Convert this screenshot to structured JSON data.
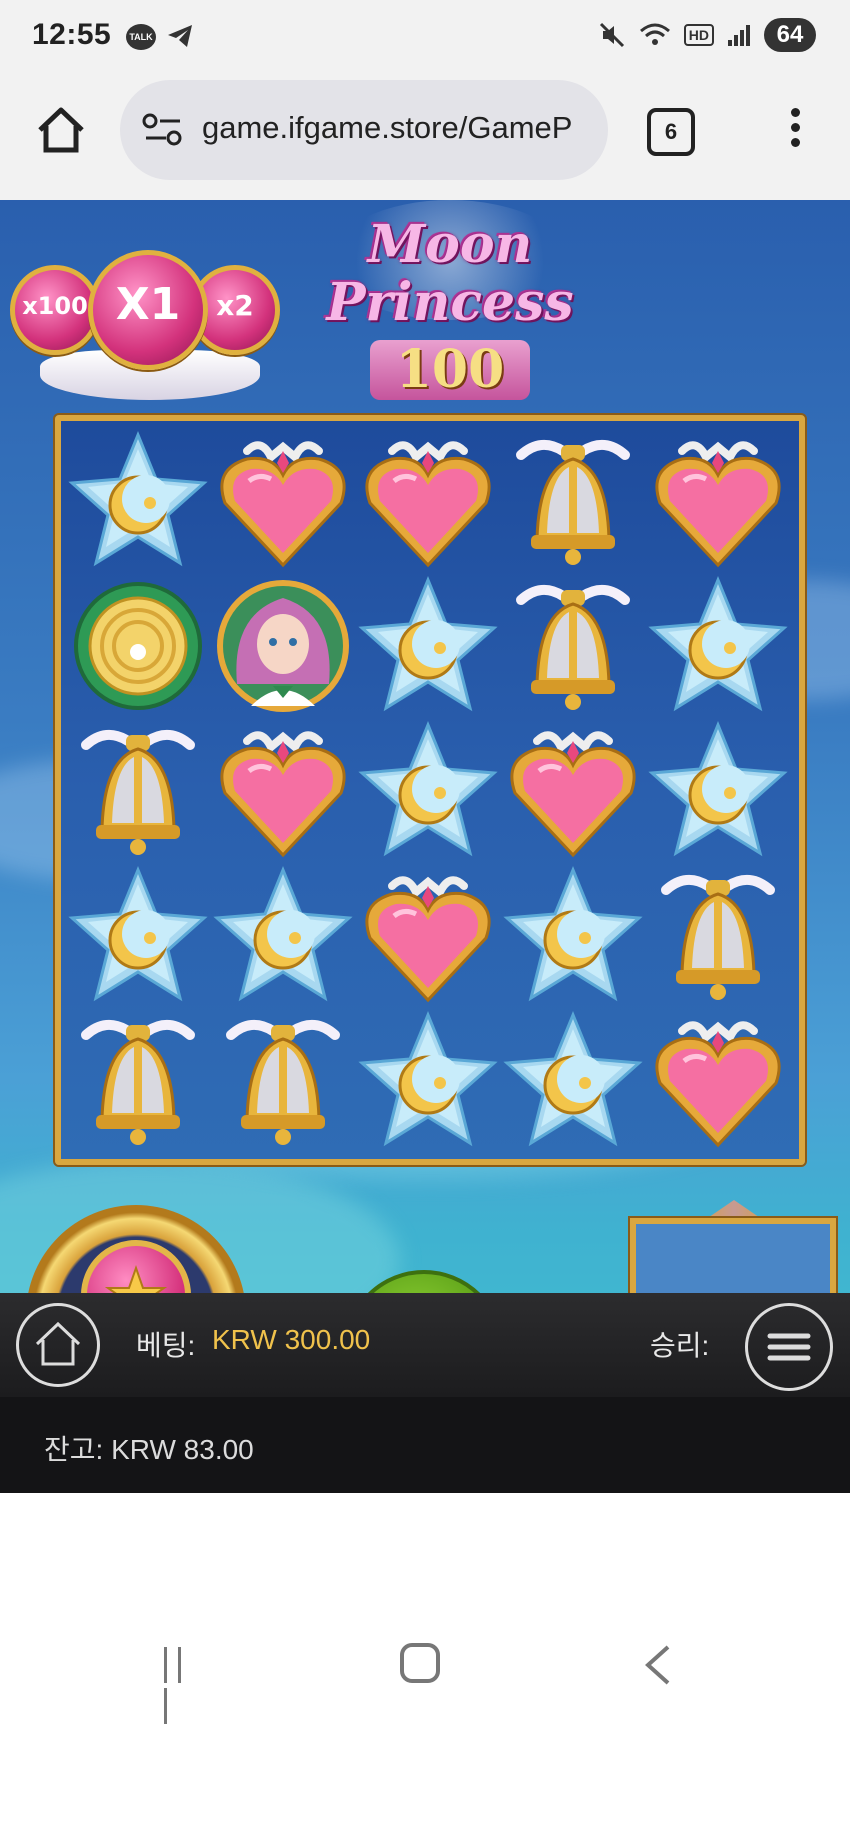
{
  "status_bar": {
    "time": "12:55",
    "talk_label": "TALK",
    "hd_label": "HD",
    "battery": "64"
  },
  "browser": {
    "url": "game.ifgame.store/GameP",
    "tab_count": "6"
  },
  "game": {
    "logo": {
      "line1": "Moon",
      "line2": "Princess",
      "badge": "100"
    },
    "multipliers": {
      "left": "x100",
      "center": "X1",
      "right": "x2"
    },
    "grid": [
      [
        "star",
        "heart",
        "heart",
        "bell",
        "heart"
      ],
      [
        "green-emblem",
        "princess",
        "star",
        "bell",
        "star"
      ],
      [
        "bell",
        "heart",
        "star",
        "heart",
        "star"
      ],
      [
        "star",
        "star",
        "heart",
        "star",
        "bell"
      ],
      [
        "bell",
        "bell",
        "star",
        "star",
        "heart"
      ]
    ]
  },
  "bottom": {
    "bet_label": "베팅:",
    "bet_value": "KRW 300.00",
    "win_label": "승리:",
    "balance": "잔고: KRW 83.00"
  },
  "colors": {
    "bet_value": "#f0c24c",
    "grid_border": "#d9a740"
  },
  "icons": [
    "talk-icon",
    "telegram-icon",
    "mute-icon",
    "wifi-icon",
    "signal-icon",
    "home-icon",
    "site-settings-icon",
    "tabs-icon",
    "more-menu-icon",
    "star-moon-icon",
    "heart-icon",
    "bell-icon",
    "emblem-icon",
    "princess-icon",
    "spin-icon",
    "game-home-icon",
    "game-menu-icon",
    "recents-icon",
    "nav-home-icon",
    "back-icon"
  ]
}
